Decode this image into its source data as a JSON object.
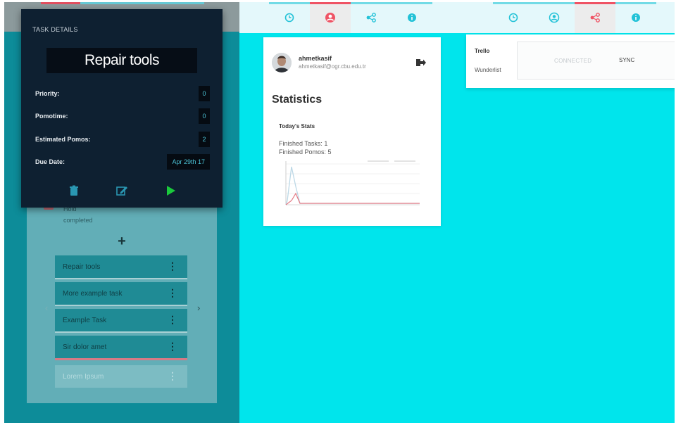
{
  "task_details": {
    "heading": "TASK DETAILS",
    "title": "Repair tools",
    "rows": [
      {
        "label": "Priority:",
        "value": "0"
      },
      {
        "label": "Pomotime:",
        "value": "0"
      },
      {
        "label": "Estimated Pomos:",
        "value": "2"
      },
      {
        "label": "Due Date:",
        "value": "Apr 29th 17"
      }
    ],
    "actions": [
      "trash-icon",
      "edit-icon",
      "play-icon"
    ]
  },
  "task_list": {
    "above_completed": "Hold",
    "completed_label": "completed",
    "add_symbol": "+",
    "items": [
      {
        "label": "Repair tools"
      },
      {
        "label": "More example task"
      },
      {
        "label": "Example Task"
      },
      {
        "label": "Sir dolor amet"
      },
      {
        "label": "Lorem Ipsum"
      }
    ],
    "kebab": "⋮",
    "prev_arrow": "‹",
    "next_arrow": "›"
  },
  "nav_tabs": [
    {
      "icon": "timer-icon",
      "active": false
    },
    {
      "icon": "user-icon",
      "active": true
    },
    {
      "icon": "share-icon",
      "active": false
    },
    {
      "icon": "info-icon",
      "active": false
    }
  ],
  "nav_tabs_right": [
    {
      "icon": "timer-icon",
      "active": false
    },
    {
      "icon": "user-icon",
      "active": false
    },
    {
      "icon": "share-icon",
      "active": true
    },
    {
      "icon": "info-icon",
      "active": false
    }
  ],
  "profile": {
    "username": "ahmetkasif",
    "email": "ahmetkasif@ogr.cbu.edu.tr",
    "statistics_title": "Statistics",
    "todays_stats_title": "Today's Stats",
    "finished_tasks": "Finished Tasks: 1",
    "finished_pomos": "Finished Pomos: 5"
  },
  "integrations": {
    "services": [
      "Trello",
      "Wunderlist"
    ],
    "status": "CONNECTED",
    "sync_label": "SYNC"
  },
  "colors": {
    "accent_cyan": "#00e5ec",
    "active_red": "#ef5364",
    "teal_bg": "#0d8c99",
    "card_dark": "#0e2031"
  }
}
